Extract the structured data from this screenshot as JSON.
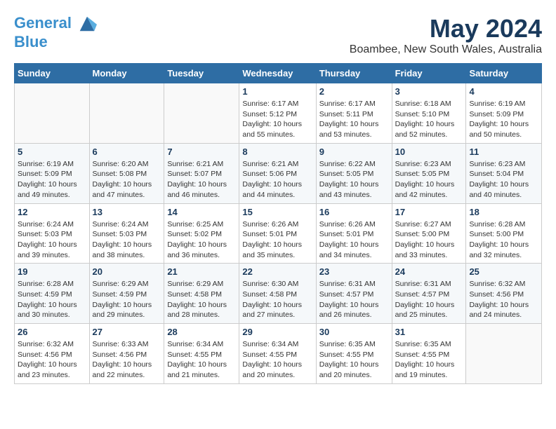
{
  "header": {
    "logo_line1": "General",
    "logo_line2": "Blue",
    "title": "May 2024",
    "subtitle": "Boambee, New South Wales, Australia"
  },
  "columns": [
    "Sunday",
    "Monday",
    "Tuesday",
    "Wednesday",
    "Thursday",
    "Friday",
    "Saturday"
  ],
  "weeks": [
    [
      {
        "day": "",
        "info": ""
      },
      {
        "day": "",
        "info": ""
      },
      {
        "day": "",
        "info": ""
      },
      {
        "day": "1",
        "info": "Sunrise: 6:17 AM\nSunset: 5:12 PM\nDaylight: 10 hours and 55 minutes."
      },
      {
        "day": "2",
        "info": "Sunrise: 6:17 AM\nSunset: 5:11 PM\nDaylight: 10 hours and 53 minutes."
      },
      {
        "day": "3",
        "info": "Sunrise: 6:18 AM\nSunset: 5:10 PM\nDaylight: 10 hours and 52 minutes."
      },
      {
        "day": "4",
        "info": "Sunrise: 6:19 AM\nSunset: 5:09 PM\nDaylight: 10 hours and 50 minutes."
      }
    ],
    [
      {
        "day": "5",
        "info": "Sunrise: 6:19 AM\nSunset: 5:09 PM\nDaylight: 10 hours and 49 minutes."
      },
      {
        "day": "6",
        "info": "Sunrise: 6:20 AM\nSunset: 5:08 PM\nDaylight: 10 hours and 47 minutes."
      },
      {
        "day": "7",
        "info": "Sunrise: 6:21 AM\nSunset: 5:07 PM\nDaylight: 10 hours and 46 minutes."
      },
      {
        "day": "8",
        "info": "Sunrise: 6:21 AM\nSunset: 5:06 PM\nDaylight: 10 hours and 44 minutes."
      },
      {
        "day": "9",
        "info": "Sunrise: 6:22 AM\nSunset: 5:05 PM\nDaylight: 10 hours and 43 minutes."
      },
      {
        "day": "10",
        "info": "Sunrise: 6:23 AM\nSunset: 5:05 PM\nDaylight: 10 hours and 42 minutes."
      },
      {
        "day": "11",
        "info": "Sunrise: 6:23 AM\nSunset: 5:04 PM\nDaylight: 10 hours and 40 minutes."
      }
    ],
    [
      {
        "day": "12",
        "info": "Sunrise: 6:24 AM\nSunset: 5:03 PM\nDaylight: 10 hours and 39 minutes."
      },
      {
        "day": "13",
        "info": "Sunrise: 6:24 AM\nSunset: 5:03 PM\nDaylight: 10 hours and 38 minutes."
      },
      {
        "day": "14",
        "info": "Sunrise: 6:25 AM\nSunset: 5:02 PM\nDaylight: 10 hours and 36 minutes."
      },
      {
        "day": "15",
        "info": "Sunrise: 6:26 AM\nSunset: 5:01 PM\nDaylight: 10 hours and 35 minutes."
      },
      {
        "day": "16",
        "info": "Sunrise: 6:26 AM\nSunset: 5:01 PM\nDaylight: 10 hours and 34 minutes."
      },
      {
        "day": "17",
        "info": "Sunrise: 6:27 AM\nSunset: 5:00 PM\nDaylight: 10 hours and 33 minutes."
      },
      {
        "day": "18",
        "info": "Sunrise: 6:28 AM\nSunset: 5:00 PM\nDaylight: 10 hours and 32 minutes."
      }
    ],
    [
      {
        "day": "19",
        "info": "Sunrise: 6:28 AM\nSunset: 4:59 PM\nDaylight: 10 hours and 30 minutes."
      },
      {
        "day": "20",
        "info": "Sunrise: 6:29 AM\nSunset: 4:59 PM\nDaylight: 10 hours and 29 minutes."
      },
      {
        "day": "21",
        "info": "Sunrise: 6:29 AM\nSunset: 4:58 PM\nDaylight: 10 hours and 28 minutes."
      },
      {
        "day": "22",
        "info": "Sunrise: 6:30 AM\nSunset: 4:58 PM\nDaylight: 10 hours and 27 minutes."
      },
      {
        "day": "23",
        "info": "Sunrise: 6:31 AM\nSunset: 4:57 PM\nDaylight: 10 hours and 26 minutes."
      },
      {
        "day": "24",
        "info": "Sunrise: 6:31 AM\nSunset: 4:57 PM\nDaylight: 10 hours and 25 minutes."
      },
      {
        "day": "25",
        "info": "Sunrise: 6:32 AM\nSunset: 4:56 PM\nDaylight: 10 hours and 24 minutes."
      }
    ],
    [
      {
        "day": "26",
        "info": "Sunrise: 6:32 AM\nSunset: 4:56 PM\nDaylight: 10 hours and 23 minutes."
      },
      {
        "day": "27",
        "info": "Sunrise: 6:33 AM\nSunset: 4:56 PM\nDaylight: 10 hours and 22 minutes."
      },
      {
        "day": "28",
        "info": "Sunrise: 6:34 AM\nSunset: 4:55 PM\nDaylight: 10 hours and 21 minutes."
      },
      {
        "day": "29",
        "info": "Sunrise: 6:34 AM\nSunset: 4:55 PM\nDaylight: 10 hours and 20 minutes."
      },
      {
        "day": "30",
        "info": "Sunrise: 6:35 AM\nSunset: 4:55 PM\nDaylight: 10 hours and 20 minutes."
      },
      {
        "day": "31",
        "info": "Sunrise: 6:35 AM\nSunset: 4:55 PM\nDaylight: 10 hours and 19 minutes."
      },
      {
        "day": "",
        "info": ""
      }
    ]
  ]
}
